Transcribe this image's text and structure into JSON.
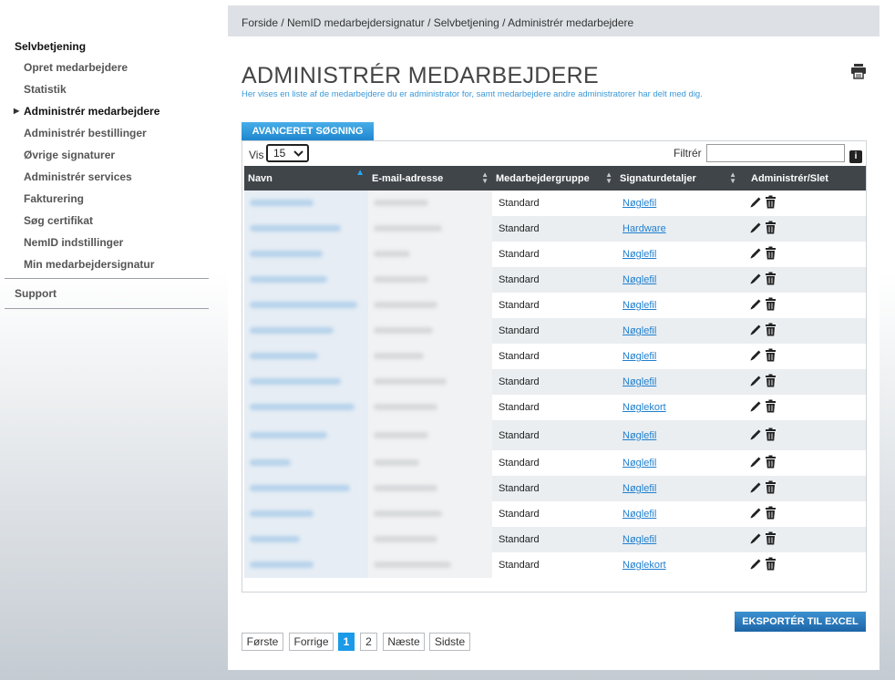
{
  "sidebar": {
    "heading": "Selvbetjening",
    "items": [
      {
        "label": "Opret medarbejdere",
        "active": false
      },
      {
        "label": "Statistik",
        "active": false
      },
      {
        "label": "Administrér medarbejdere",
        "active": true
      },
      {
        "label": "Administrér bestillinger",
        "active": false
      },
      {
        "label": "Øvrige signaturer",
        "active": false
      },
      {
        "label": "Administrér services",
        "active": false
      },
      {
        "label": "Fakturering",
        "active": false
      },
      {
        "label": "Søg certifikat",
        "active": false
      },
      {
        "label": "NemID indstillinger",
        "active": false
      },
      {
        "label": "Min medarbejdersignatur",
        "active": false
      }
    ],
    "support": "Support"
  },
  "breadcrumb": "Forside / NemID medarbejdersignatur / Selvbetjening / Administrér medarbejdere",
  "page": {
    "title": "ADMINISTRÉR MEDARBEJDERE",
    "subtitle": "Her vises en liste af de medarbejdere du er administrator for, samt medarbejdere andre administratorer har delt med dig."
  },
  "advanced_search": "AVANCERET SØGNING",
  "controls": {
    "show_label": "Vis",
    "page_size": "15",
    "filter_label": "Filtrér",
    "filter_value": "",
    "info_icon": "i"
  },
  "table": {
    "columns": [
      "Navn",
      "E-mail-adresse",
      "Medarbejdergruppe",
      "Signaturdetaljer",
      "Administrér/Slet"
    ],
    "rows": [
      {
        "group": "Standard",
        "sig": "Nøglefil"
      },
      {
        "group": "Standard",
        "sig": "Hardware"
      },
      {
        "group": "Standard",
        "sig": "Nøglefil"
      },
      {
        "group": "Standard",
        "sig": "Nøglefil"
      },
      {
        "group": "Standard",
        "sig": "Nøglefil"
      },
      {
        "group": "Standard",
        "sig": "Nøglefil"
      },
      {
        "group": "Standard",
        "sig": "Nøglefil"
      },
      {
        "group": "Standard",
        "sig": "Nøglefil"
      },
      {
        "group": "Standard",
        "sig": "Nøglekort"
      },
      {
        "group": "Standard",
        "sig": "Nøglefil"
      },
      {
        "group": "Standard",
        "sig": "Nøglefil"
      },
      {
        "group": "Standard",
        "sig": "Nøglefil"
      },
      {
        "group": "Standard",
        "sig": "Nøglefil"
      },
      {
        "group": "Standard",
        "sig": "Nøglefil"
      },
      {
        "group": "Standard",
        "sig": "Nøglekort"
      }
    ]
  },
  "export_button": "EKSPORTÉR TIL EXCEL",
  "pagination": {
    "first": "Første",
    "prev": "Forrige",
    "pages": [
      "1",
      "2"
    ],
    "current": "1",
    "next": "Næste",
    "last": "Sidste"
  },
  "colors": {
    "accent": "#1a9ae8",
    "link": "#1f7fcf",
    "header_bg": "#3f4549"
  }
}
